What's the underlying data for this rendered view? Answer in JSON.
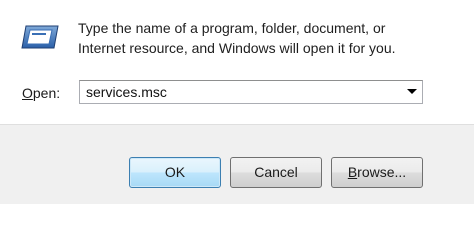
{
  "dialog": {
    "description_line1": "Type the name of a program, folder, document, or",
    "description_line2": "Internet resource, and Windows will open it for you.",
    "icon": "run-program-icon"
  },
  "open_field": {
    "label_accel": "O",
    "label_rest": "pen:",
    "value": "services.msc",
    "dropdown_icon": "chevron-down-icon"
  },
  "buttons": {
    "ok": "OK",
    "cancel": "Cancel",
    "browse_accel": "B",
    "browse_rest": "rowse..."
  },
  "colors": {
    "footer_bg": "#f0f0f0",
    "ok_border": "#3c7fb1"
  }
}
